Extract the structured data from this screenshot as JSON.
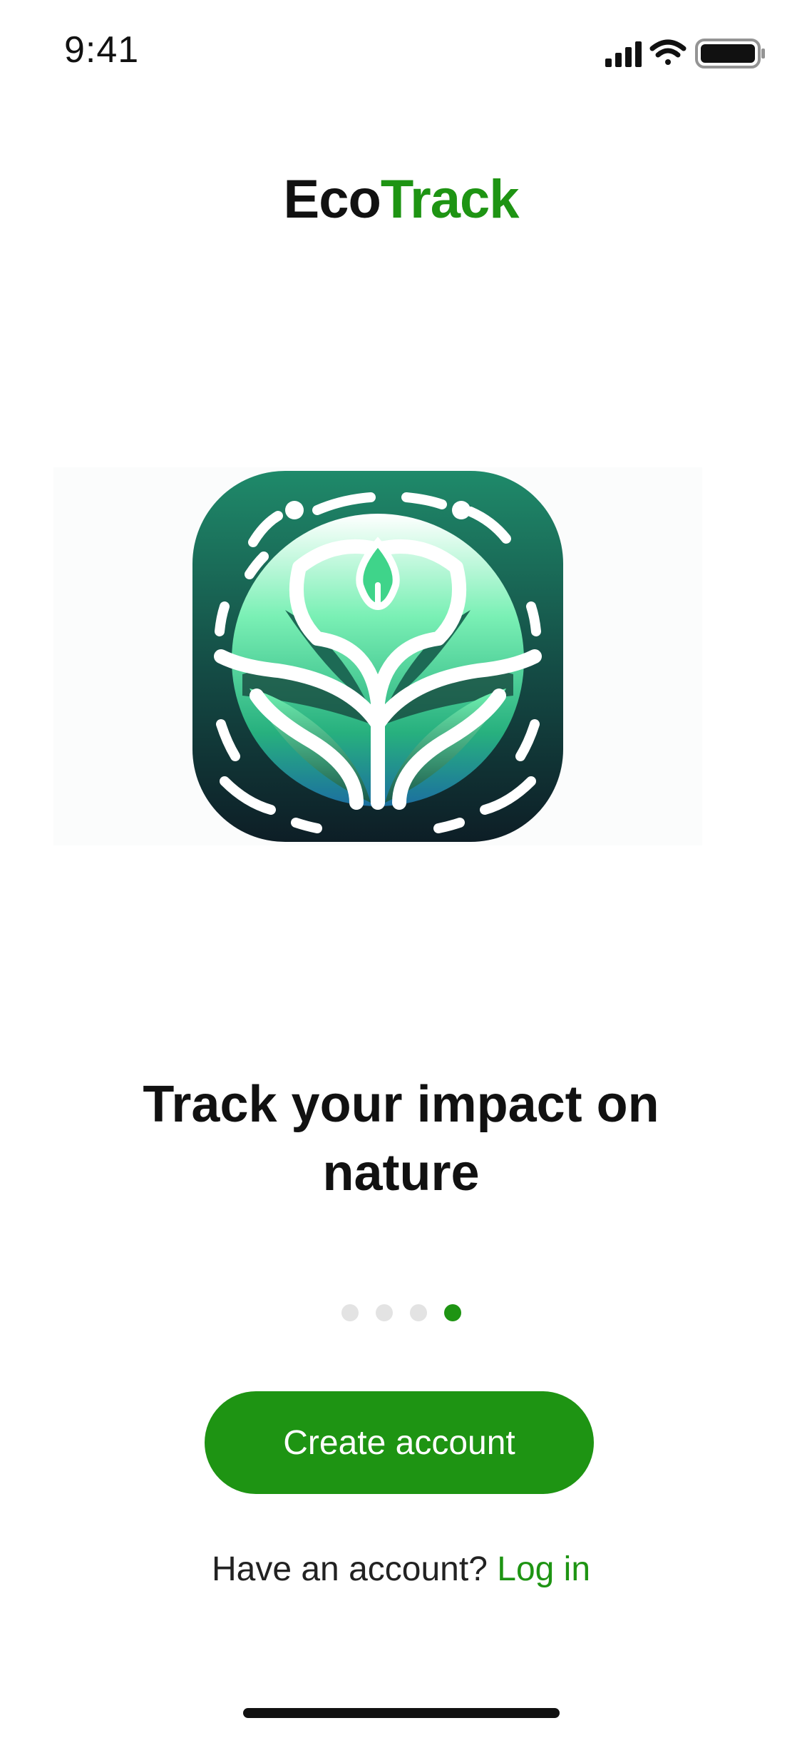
{
  "status_bar": {
    "time": "9:41"
  },
  "brand": {
    "eco": "Eco",
    "track": "Track"
  },
  "hero": {
    "icon": "ecotrack-plant-globe-logo"
  },
  "headline": "Track your impact on nature",
  "pager": {
    "total": 4,
    "active_index": 3
  },
  "cta": {
    "create_account_label": "Create account"
  },
  "login": {
    "prompt": "Have an account?",
    "link_label": "Log in"
  },
  "colors": {
    "accent": "#1e9413",
    "text": "#111111",
    "dot_inactive": "#e3e3e3",
    "logo_dark": "#0f2a2a",
    "logo_teal": "#1f6f57",
    "logo_mint": "#5ff0a8"
  }
}
